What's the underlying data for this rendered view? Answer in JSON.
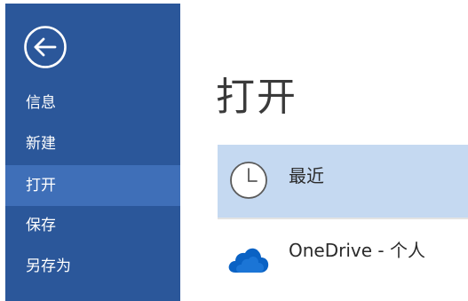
{
  "colors": {
    "sidebar_bg": "#2b579a",
    "sidebar_active": "#3f6fb8",
    "selected_item_bg": "#c5d9f1"
  },
  "back_button": {
    "icon": "arrow-left-circle-icon"
  },
  "sidebar": {
    "items": [
      {
        "label": "信息",
        "active": false
      },
      {
        "label": "新建",
        "active": false
      },
      {
        "label": "打开",
        "active": true
      },
      {
        "label": "保存",
        "active": false
      },
      {
        "label": "另存为",
        "active": false
      }
    ]
  },
  "main": {
    "title": "打开",
    "locations": [
      {
        "label": "最近",
        "icon": "clock-icon",
        "selected": true
      },
      {
        "label": "OneDrive - 个人",
        "icon": "onedrive-cloud-icon",
        "selected": false
      }
    ]
  }
}
